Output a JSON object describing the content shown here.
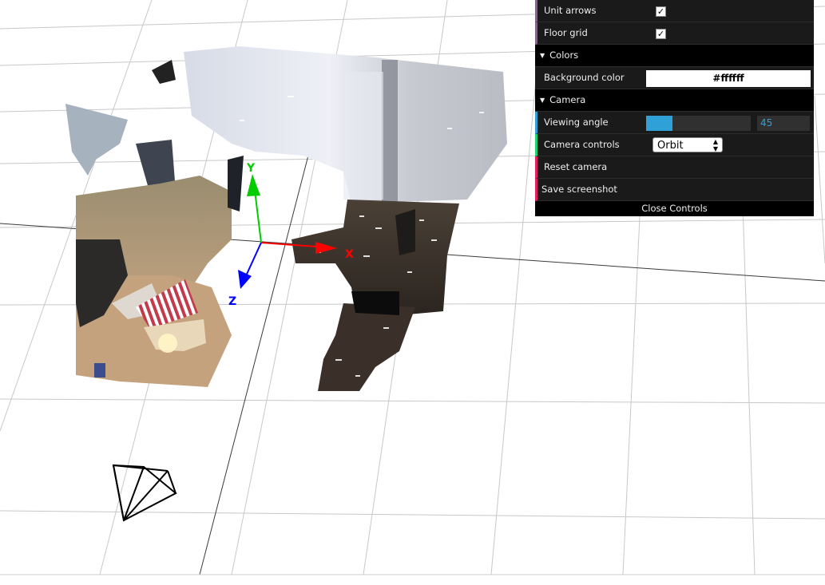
{
  "scene": {
    "axes": {
      "x_label": "X",
      "y_label": "Y",
      "z_label": "Z"
    },
    "colors": {
      "x_axis": "#ff0000",
      "y_axis": "#00cc00",
      "z_axis": "#0000ff",
      "grid": "#c8c8c8"
    }
  },
  "controls": {
    "unit_arrows": {
      "label": "Unit arrows",
      "checked": true
    },
    "floor_grid": {
      "label": "Floor grid",
      "checked": true
    },
    "colors_folder": "Colors",
    "background_color": {
      "label": "Background color",
      "value": "#ffffff"
    },
    "camera_folder": "Camera",
    "viewing_angle": {
      "label": "Viewing angle",
      "value": "45",
      "fill_fraction": 0.25
    },
    "camera_controls": {
      "label": "Camera controls",
      "value": "Orbit"
    },
    "reset_camera": "Reset camera",
    "save_screenshot": "Save screenshot",
    "close_controls": "Close Controls"
  },
  "icons": {
    "checkbox": "checkmark-icon",
    "folder": "triangle-down-icon",
    "select": "updown-arrow-icon"
  }
}
